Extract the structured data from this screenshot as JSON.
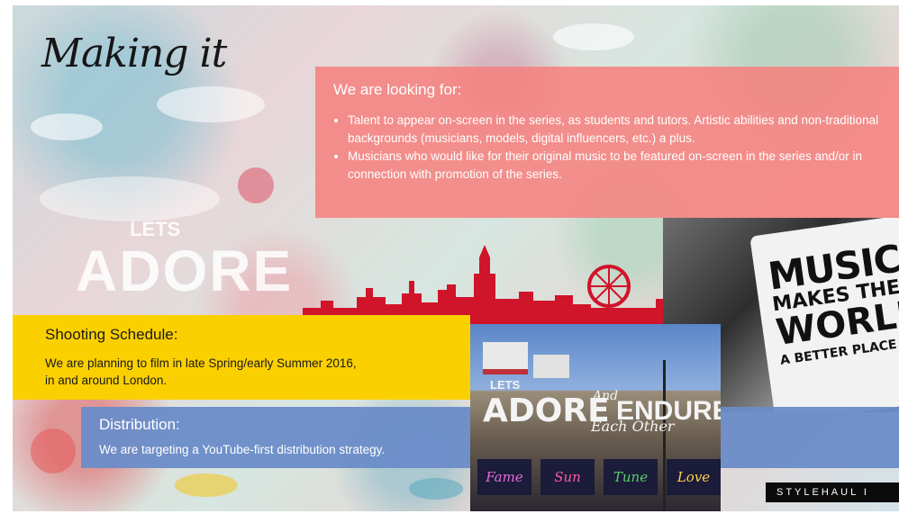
{
  "slide": {
    "title": "Making it",
    "looking_for": {
      "heading": "We are looking for:",
      "items": [
        "Talent to appear on-screen in the series, as students and tutors. Artistic abilities and non-traditional backgrounds (musicians, models, digital influencers, etc.) a plus.",
        "Musicians who would like for their original music to be featured on-screen in the series and/or in connection with promotion of the series."
      ]
    },
    "shooting": {
      "heading": "Shooting Schedule:",
      "line1": "We are planning to film in late Spring/early Summer 2016,",
      "line2": "in and around London."
    },
    "distribution": {
      "heading": "Distribution:",
      "text": "We are targeting a YouTube-first distribution strategy."
    },
    "background_text": {
      "lets": "LETS",
      "adore": "ADORE"
    },
    "bag_text": {
      "line1": "MUSIC",
      "line2": "MAKES THE",
      "line3": "WORLD",
      "line4": "A BETTER PLACE"
    },
    "building_sign": {
      "lets": "LETS",
      "adore": "ADORE",
      "and": "And",
      "endure": "ENDURE",
      "each_other": "Each Other",
      "tiles": [
        "Fame",
        "Sun",
        "Tune",
        "Love"
      ]
    },
    "brand": "STYLEHAUL I"
  },
  "colors": {
    "salmon": "#f58280",
    "yellow": "#fbd000",
    "blue": "#6a8cc8",
    "skyline_red": "#d0142a"
  }
}
